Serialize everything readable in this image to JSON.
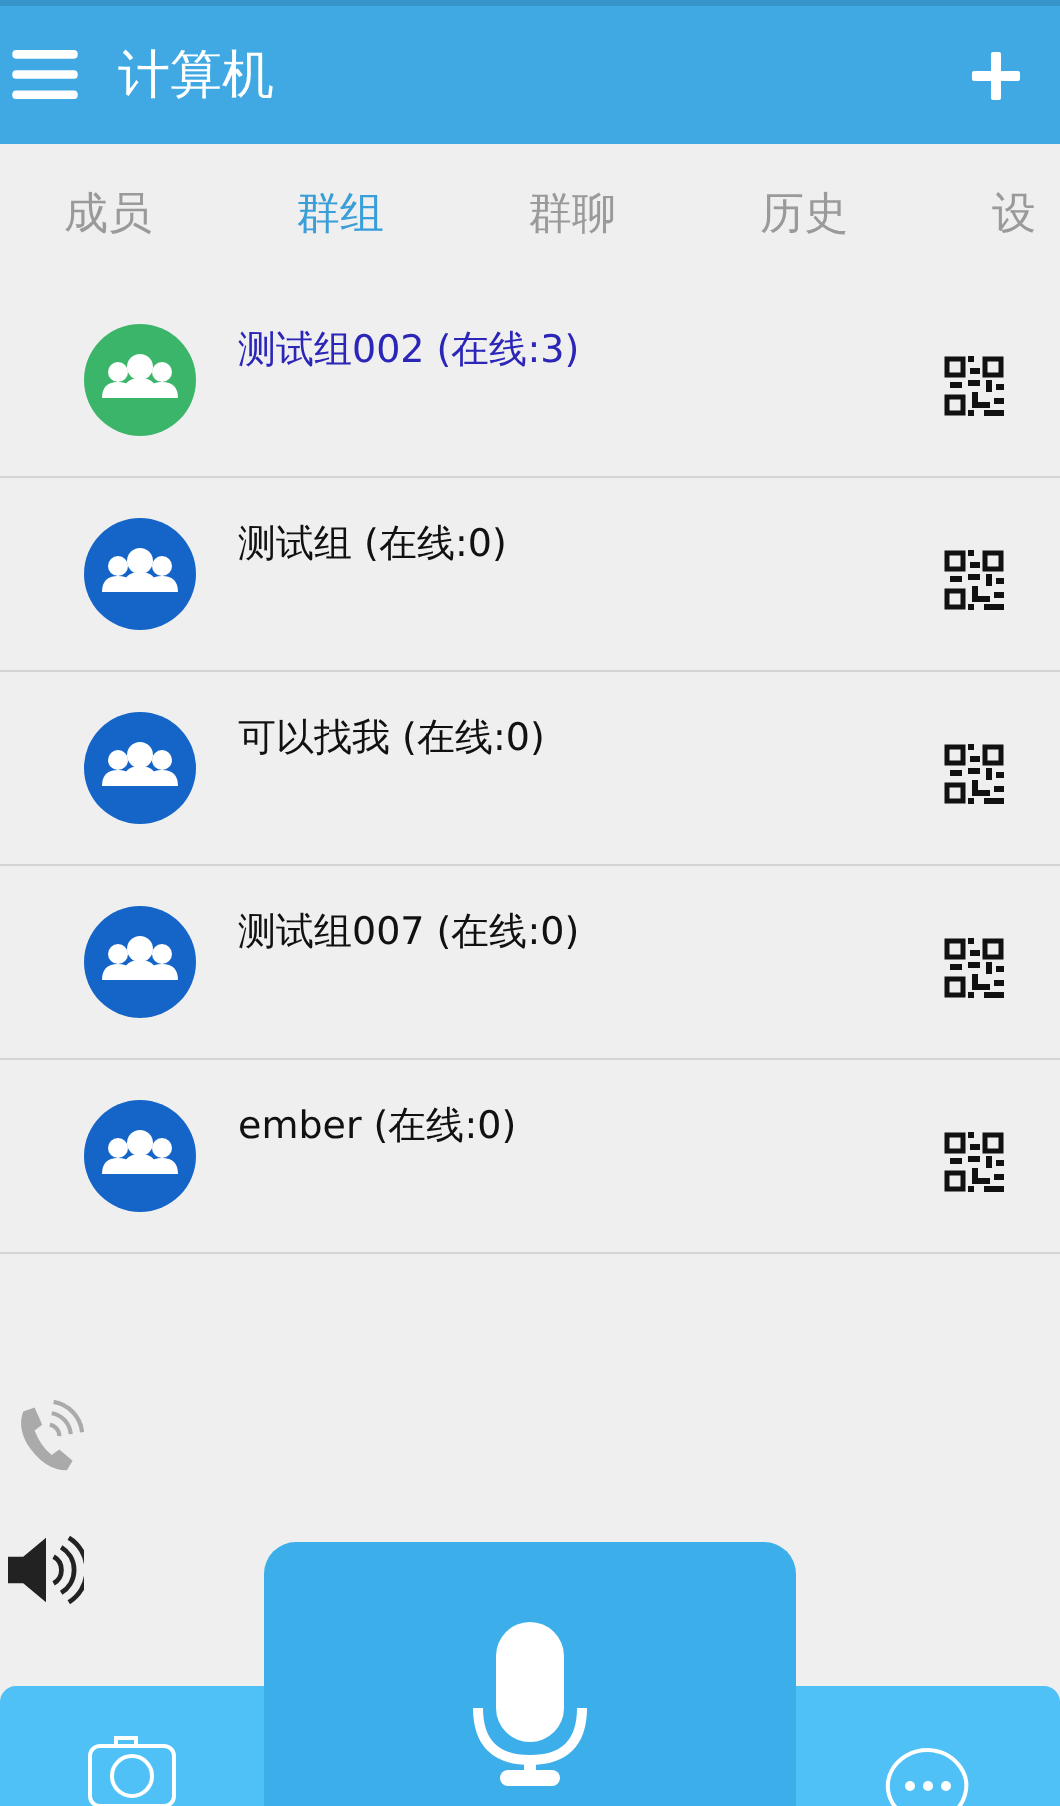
{
  "header": {
    "title": "计算机"
  },
  "tabs": [
    {
      "label": "成员",
      "selected": false
    },
    {
      "label": "群组",
      "selected": true
    },
    {
      "label": "群聊",
      "selected": false
    },
    {
      "label": "历史",
      "selected": false
    },
    {
      "label": "设",
      "selected": false
    }
  ],
  "groups": [
    {
      "name": "测试组002  (在线:3)",
      "selected": true
    },
    {
      "name": "测试组  (在线:0)",
      "selected": false
    },
    {
      "name": "可以找我  (在线:0)",
      "selected": false
    },
    {
      "name": "测试组007  (在线:0)",
      "selected": false
    },
    {
      "name": "ember  (在线:0)",
      "selected": false
    }
  ]
}
